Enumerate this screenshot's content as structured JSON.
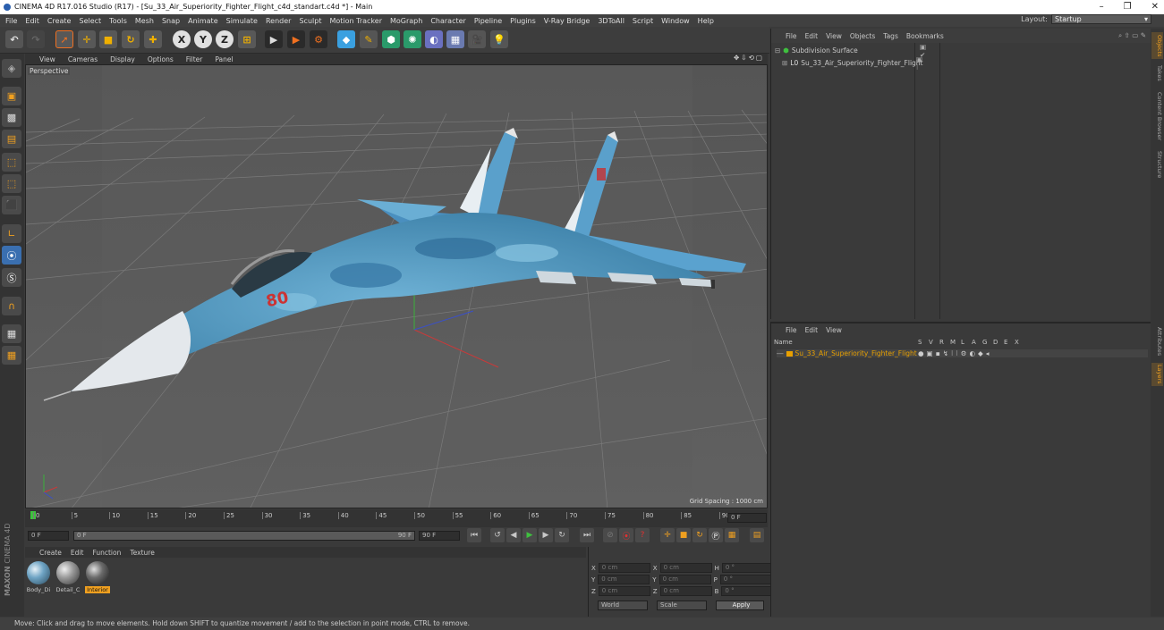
{
  "window": {
    "title": "CINEMA 4D R17.016 Studio (R17) - [Su_33_Air_Superiority_Fighter_Flight_c4d_standart.c4d *] - Main"
  },
  "menu": [
    "File",
    "Edit",
    "Create",
    "Select",
    "Tools",
    "Mesh",
    "Snap",
    "Animate",
    "Simulate",
    "Render",
    "Sculpt",
    "Motion Tracker",
    "MoGraph",
    "Character",
    "Pipeline",
    "Plugins",
    "V-Ray Bridge",
    "3DToAll",
    "Script",
    "Window",
    "Help"
  ],
  "layout": {
    "label": "Layout:",
    "value": "Startup"
  },
  "viewport": {
    "menu": [
      "View",
      "Cameras",
      "Display",
      "Options",
      "Filter",
      "Panel"
    ],
    "label": "Perspective",
    "grid_spacing": "Grid Spacing : 1000 cm",
    "aircraft_marking": "80"
  },
  "timeline": {
    "ticks": [
      "0",
      "5",
      "10",
      "15",
      "20",
      "25",
      "30",
      "35",
      "40",
      "45",
      "50",
      "55",
      "60",
      "65",
      "70",
      "75",
      "80",
      "85",
      "90"
    ],
    "current_frame": "0 F"
  },
  "anim": {
    "start": "0 F",
    "slider_start": "0 F",
    "slider_end": "90 F",
    "end": "90 F"
  },
  "materials": {
    "menu": [
      "Create",
      "Edit",
      "Function",
      "Texture"
    ],
    "items": [
      {
        "name": "Body_Di"
      },
      {
        "name": "Detail_C"
      },
      {
        "name": "Interior"
      }
    ]
  },
  "coords": {
    "rows": [
      {
        "a": "X",
        "av": "0 cm",
        "b": "X",
        "bv": "0 cm",
        "c": "H",
        "cv": "0 °"
      },
      {
        "a": "Y",
        "av": "0 cm",
        "b": "Y",
        "bv": "0 cm",
        "c": "P",
        "cv": "0 °"
      },
      {
        "a": "Z",
        "av": "0 cm",
        "b": "Z",
        "bv": "0 cm",
        "c": "B",
        "cv": "0 °"
      }
    ],
    "world": "World",
    "scale": "Scale",
    "apply": "Apply"
  },
  "objects": {
    "menu": [
      "File",
      "Edit",
      "View",
      "Objects",
      "Tags",
      "Bookmarks"
    ],
    "items": [
      "Subdivision Surface",
      "Su_33_Air_Superiority_Fighter_Flight"
    ]
  },
  "layers": {
    "menu": [
      "File",
      "Edit",
      "View"
    ],
    "header": {
      "name": "Name",
      "flags": [
        "S",
        "V",
        "R",
        "M",
        "L",
        "A",
        "G",
        "D",
        "E",
        "X"
      ]
    },
    "items": [
      "Su_33_Air_Superiority_Fighter_Flight"
    ]
  },
  "right_tabs": [
    "Objects",
    "Takes",
    "Content Browser",
    "Structure",
    "Attributes",
    "Layers"
  ],
  "status": "Move: Click and drag to move elements. Hold down SHIFT to quantize movement / add to the selection in point mode, CTRL to remove.",
  "brand": {
    "maxon": "MAXON",
    "product": "CINEMA 4D"
  },
  "colors": {
    "accent": "#f0a020",
    "selected_layer": "#e8a000",
    "active_tool": "#f0b000",
    "axis_x": "#d04040",
    "axis_y": "#40c040",
    "axis_z": "#4060d0"
  }
}
